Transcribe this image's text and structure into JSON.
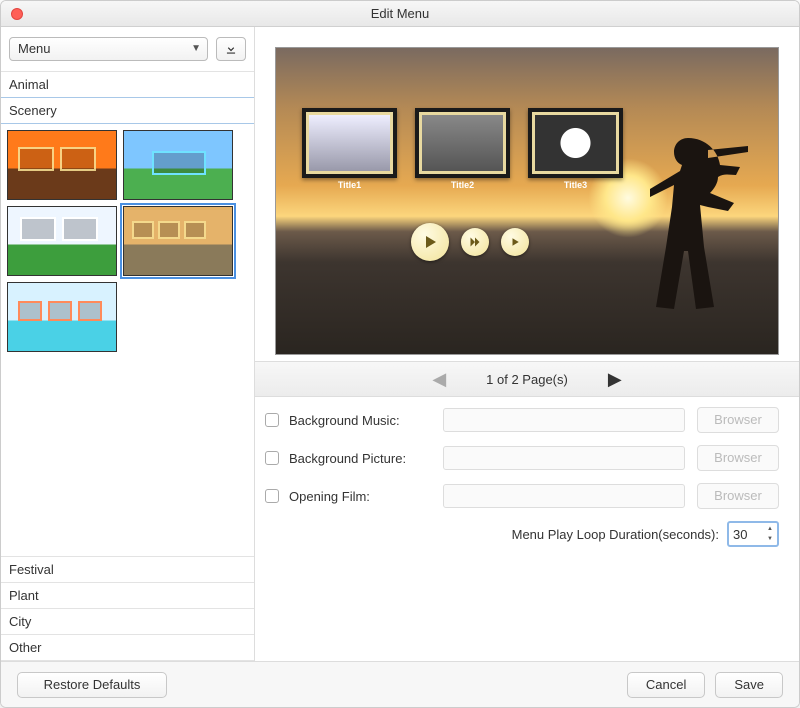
{
  "window": {
    "title": "Edit Menu"
  },
  "sidebar": {
    "dropdown_value": "Menu",
    "categories_top": [
      "Animal",
      "Scenery"
    ],
    "active_category": "Scenery",
    "categories_bottom": [
      "Festival",
      "Plant",
      "City",
      "Other"
    ]
  },
  "preview": {
    "frames": [
      {
        "label": "Title1"
      },
      {
        "label": "Title2"
      },
      {
        "label": "Title3"
      }
    ],
    "pager_text": "1 of 2 Page(s)"
  },
  "settings": {
    "bg_music_label": "Background Music:",
    "bg_picture_label": "Background Picture:",
    "opening_film_label": "Opening Film:",
    "browser_label": "Browser",
    "loop_label": "Menu Play Loop Duration(seconds):",
    "loop_value": "30"
  },
  "footer": {
    "restore_label": "Restore Defaults",
    "cancel_label": "Cancel",
    "save_label": "Save"
  }
}
